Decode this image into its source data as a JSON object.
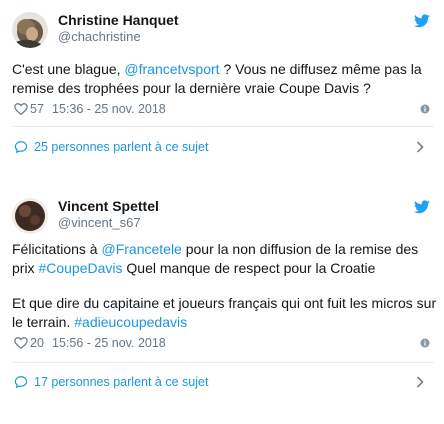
{
  "tweets": [
    {
      "name": "Christine Hanquet",
      "handle": "@chachristine",
      "text_parts": [
        {
          "t": "C'est une blague, ",
          "link": false
        },
        {
          "t": "@francetvsport",
          "link": true
        },
        {
          "t": " ?  Vous ne diffusez même pas la remise des trophées pour la dernière vraie Coupe Davis ?",
          "link": false
        }
      ],
      "likes": "57",
      "timestamp": "15:36 - 25 nov. 2018",
      "conversation": "25 personnes parlent à ce sujet"
    },
    {
      "name": "Vincent Spettel",
      "handle": "@vincent_s67",
      "paragraphs": [
        [
          {
            "t": "Félicitations à ",
            "link": false
          },
          {
            "t": "@Francetele",
            "link": true
          },
          {
            "t": " pour la non diffusion de la remise des prix ",
            "link": false
          },
          {
            "t": "#CoupeDavis",
            "link": true
          },
          {
            "t": " Quel manque de respect pour la Croatie",
            "link": false
          }
        ],
        [
          {
            "t": "Et que dire du capitaine et joueurs français qui ont fuit les micros sur le terrain. ",
            "link": false
          },
          {
            "t": "#adieucoupedavis",
            "link": true
          }
        ]
      ],
      "likes": "20",
      "timestamp": "15:56 - 25 nov. 2018",
      "conversation": "17 personnes parlent à ce sujet"
    }
  ],
  "colors": {
    "link": "#1b95e0",
    "muted": "#657786",
    "text": "#14171a",
    "divider": "#e6ecf0"
  },
  "icons": [
    "twitter-bird-icon",
    "heart-icon",
    "info-icon",
    "speech-bubble-icon",
    "chevron-right-icon"
  ]
}
